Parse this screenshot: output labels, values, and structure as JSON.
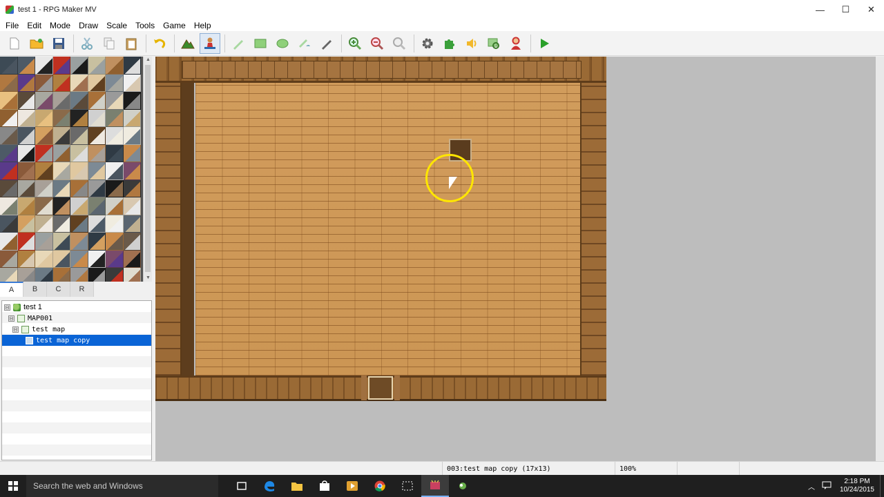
{
  "window": {
    "title": "test 1 - RPG Maker MV",
    "minimize": "—",
    "maximize": "☐",
    "close": "✕"
  },
  "menu": [
    "File",
    "Edit",
    "Mode",
    "Draw",
    "Scale",
    "Tools",
    "Game",
    "Help"
  ],
  "toolbar": {
    "groups": [
      [
        "new-project",
        "open-project",
        "save-project"
      ],
      [
        "cut",
        "copy",
        "paste"
      ],
      [
        "undo"
      ],
      [
        "map-mode",
        "event-mode"
      ],
      [
        "pencil",
        "rectangle",
        "ellipse",
        "fill",
        "shadow-pen"
      ],
      [
        "zoom-in",
        "zoom-out",
        "actual-size"
      ],
      [
        "database",
        "plugin-manager",
        "sound-test",
        "event-searcher",
        "character-generator"
      ],
      [
        "playtest"
      ]
    ],
    "active_tool": "event-mode"
  },
  "tileset_tabs": [
    "A",
    "B",
    "C",
    "R"
  ],
  "selected_tab": "A",
  "map_tree": [
    {
      "label": "test 1",
      "level": 0,
      "type": "project",
      "expander": "⊟"
    },
    {
      "label": "MAP001",
      "level": 1,
      "type": "map",
      "expander": "⊟"
    },
    {
      "label": "test map",
      "level": 2,
      "type": "map",
      "expander": "⊟"
    },
    {
      "label": "test map copy",
      "level": 3,
      "type": "map",
      "expander": "",
      "selected": true
    }
  ],
  "status": {
    "map_info": "003:test map copy (17x13)",
    "zoom": "100%"
  },
  "taskbar": {
    "search_placeholder": "Search the web and Windows",
    "time": "2:18 PM",
    "date": "10/24/2015"
  },
  "colors": {
    "selection": "#0a64d6",
    "cursor_highlight": "#ffe600",
    "floor": "#cc9654",
    "wall": "#8b5e2f"
  }
}
